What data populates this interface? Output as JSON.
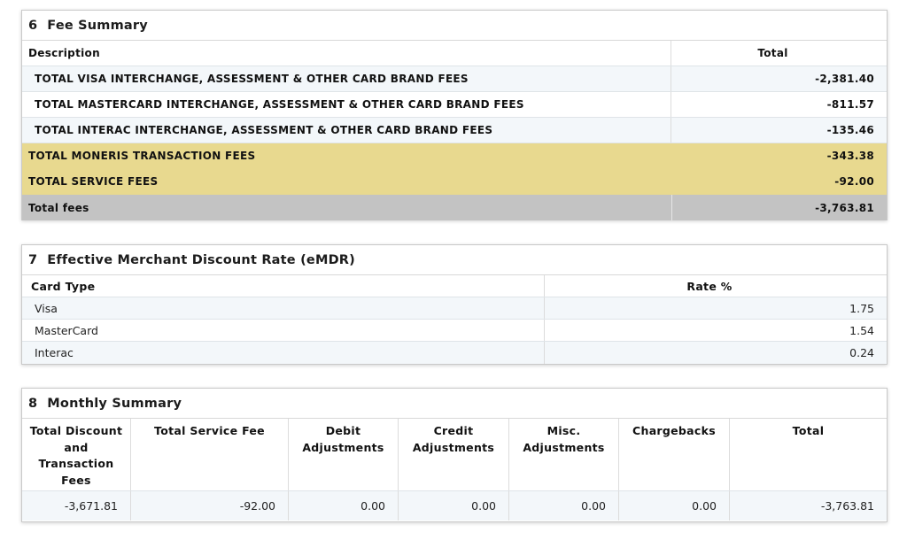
{
  "fee_summary": {
    "number": "6",
    "title": "Fee Summary",
    "columns": [
      "Description",
      "Total"
    ],
    "rows": [
      {
        "description": "TOTAL VISA INTERCHANGE, ASSESSMENT & OTHER CARD BRAND FEES",
        "total": "-2,381.40"
      },
      {
        "description": "TOTAL MASTERCARD INTERCHANGE, ASSESSMENT & OTHER CARD BRAND FEES",
        "total": "-811.57"
      },
      {
        "description": "TOTAL INTERAC INTERCHANGE, ASSESSMENT & OTHER CARD BRAND FEES",
        "total": "-135.46"
      },
      {
        "description": "TOTAL MONERIS TRANSACTION FEES",
        "total": "-343.38"
      },
      {
        "description": "TOTAL SERVICE FEES",
        "total": "-92.00"
      }
    ],
    "total_row": {
      "label": "Total fees",
      "total": "-3,763.81"
    },
    "highlight_color": "#e8d98f",
    "total_row_color": "#c3c3c3"
  },
  "emdr": {
    "number": "7",
    "title": "Effective Merchant Discount Rate (eMDR)",
    "columns": [
      "Card Type",
      "Rate %"
    ],
    "rows": [
      {
        "card_type": "Visa",
        "rate": "1.75"
      },
      {
        "card_type": "MasterCard",
        "rate": "1.54"
      },
      {
        "card_type": "Interac",
        "rate": "0.24"
      }
    ]
  },
  "monthly_summary": {
    "number": "8",
    "title": "Monthly Summary",
    "columns": [
      "Total Discount and Transaction Fees",
      "Total Service Fee",
      "Debit Adjustments",
      "Credit Adjustments",
      "Misc. Adjustments",
      "Chargebacks",
      "Total"
    ],
    "values": [
      "-3,671.81",
      "-92.00",
      "0.00",
      "0.00",
      "0.00",
      "0.00",
      "-3,763.81"
    ]
  }
}
